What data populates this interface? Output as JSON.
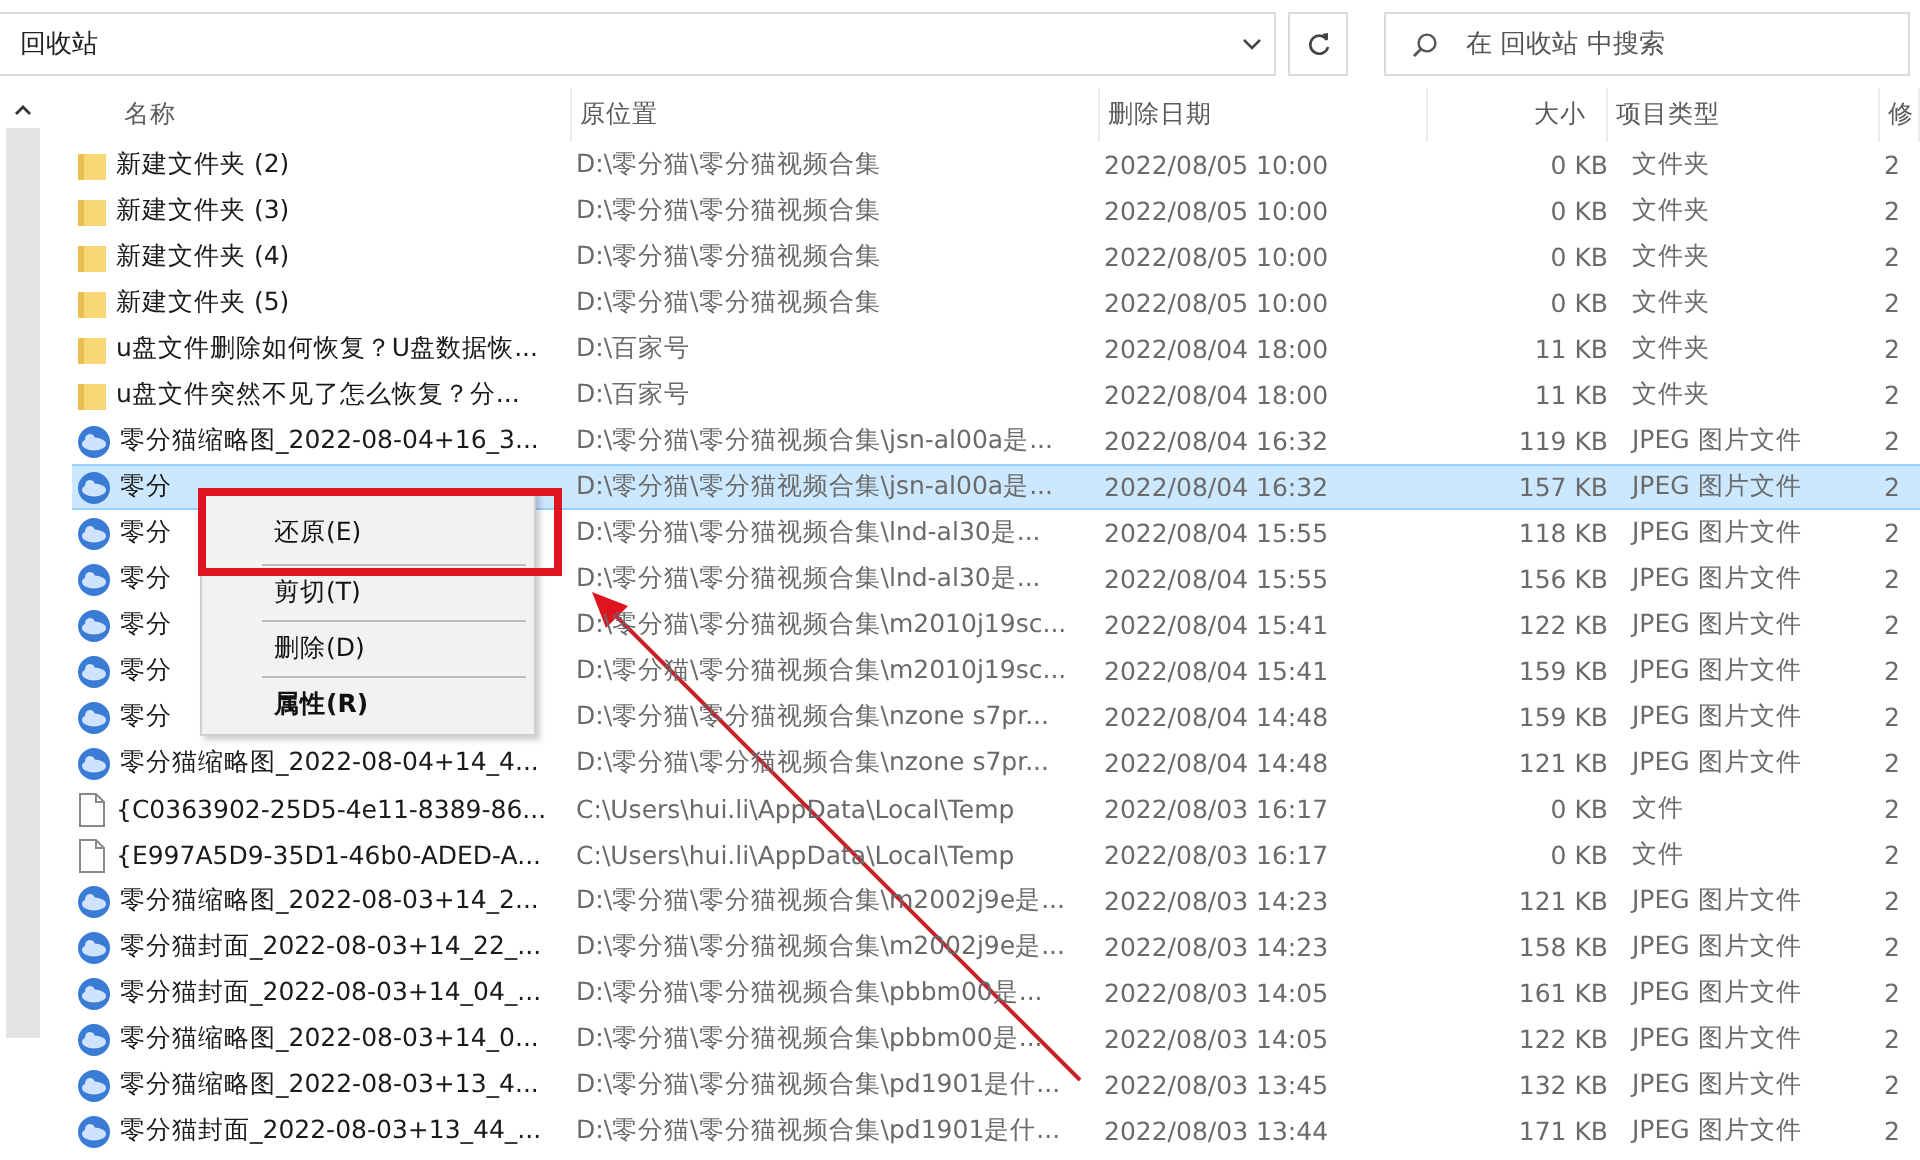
{
  "address_bar": {
    "path": "回收站"
  },
  "search": {
    "placeholder": "在 回收站 中搜索"
  },
  "table": {
    "columns": [
      "名称",
      "原位置",
      "删除日期",
      "大小",
      "项目类型",
      "修"
    ],
    "rows": [
      {
        "kind": "folder",
        "selected": false,
        "cells": [
          "新建文件夹 (2)",
          "D:\\零分猫\\零分猫视频合集",
          "2022/08/05 10:00",
          "0 KB",
          "文件夹",
          "2"
        ]
      },
      {
        "kind": "folder",
        "selected": false,
        "cells": [
          "新建文件夹 (3)",
          "D:\\零分猫\\零分猫视频合集",
          "2022/08/05 10:00",
          "0 KB",
          "文件夹",
          "2"
        ]
      },
      {
        "kind": "folder",
        "selected": false,
        "cells": [
          "新建文件夹 (4)",
          "D:\\零分猫\\零分猫视频合集",
          "2022/08/05 10:00",
          "0 KB",
          "文件夹",
          "2"
        ]
      },
      {
        "kind": "folder",
        "selected": false,
        "cells": [
          "新建文件夹 (5)",
          "D:\\零分猫\\零分猫视频合集",
          "2022/08/05 10:00",
          "0 KB",
          "文件夹",
          "2"
        ]
      },
      {
        "kind": "folder",
        "selected": false,
        "cells": [
          "u盘文件删除如何恢复？U盘数据恢...",
          "D:\\百家号",
          "2022/08/04 18:00",
          "11 KB",
          "文件夹",
          "2"
        ]
      },
      {
        "kind": "folder",
        "selected": false,
        "cells": [
          "u盘文件突然不见了怎么恢复？分...",
          "D:\\百家号",
          "2022/08/04 18:00",
          "11 KB",
          "文件夹",
          "2"
        ]
      },
      {
        "kind": "image",
        "selected": false,
        "cells": [
          "零分猫缩略图_2022-08-04+16_3...",
          "D:\\零分猫\\零分猫视频合集\\jsn-al00a是...",
          "2022/08/04 16:32",
          "119 KB",
          "JPEG 图片文件",
          "2"
        ]
      },
      {
        "kind": "image",
        "selected": true,
        "cells": [
          "零分",
          "D:\\零分猫\\零分猫视频合集\\jsn-al00a是...",
          "2022/08/04 16:32",
          "157 KB",
          "JPEG 图片文件",
          "2"
        ]
      },
      {
        "kind": "image",
        "selected": false,
        "cells": [
          "零分",
          "D:\\零分猫\\零分猫视频合集\\lnd-al30是...",
          "2022/08/04 15:55",
          "118 KB",
          "JPEG 图片文件",
          "2"
        ]
      },
      {
        "kind": "image",
        "selected": false,
        "cells": [
          "零分",
          "D:\\零分猫\\零分猫视频合集\\lnd-al30是...",
          "2022/08/04 15:55",
          "156 KB",
          "JPEG 图片文件",
          "2"
        ]
      },
      {
        "kind": "image",
        "selected": false,
        "cells": [
          "零分",
          "D:\\零分猫\\零分猫视频合集\\m2010j19sc...",
          "2022/08/04 15:41",
          "122 KB",
          "JPEG 图片文件",
          "2"
        ]
      },
      {
        "kind": "image",
        "selected": false,
        "cells": [
          "零分",
          "D:\\零分猫\\零分猫视频合集\\m2010j19sc...",
          "2022/08/04 15:41",
          "159 KB",
          "JPEG 图片文件",
          "2"
        ]
      },
      {
        "kind": "image",
        "selected": false,
        "cells": [
          "零分",
          "D:\\零分猫\\零分猫视频合集\\nzone s7pr...",
          "2022/08/04 14:48",
          "159 KB",
          "JPEG 图片文件",
          "2"
        ]
      },
      {
        "kind": "image",
        "selected": false,
        "cells": [
          "零分猫缩略图_2022-08-04+14_4...",
          "D:\\零分猫\\零分猫视频合集\\nzone s7pr...",
          "2022/08/04 14:48",
          "121 KB",
          "JPEG 图片文件",
          "2"
        ]
      },
      {
        "kind": "file",
        "selected": false,
        "cells": [
          "{C0363902-25D5-4e11-8389-86...",
          "C:\\Users\\hui.li\\AppData\\Local\\Temp",
          "2022/08/03 16:17",
          "0 KB",
          "文件",
          "2"
        ]
      },
      {
        "kind": "file",
        "selected": false,
        "cells": [
          "{E997A5D9-35D1-46b0-ADED-A...",
          "C:\\Users\\hui.li\\AppData\\Local\\Temp",
          "2022/08/03 16:17",
          "0 KB",
          "文件",
          "2"
        ]
      },
      {
        "kind": "image",
        "selected": false,
        "cells": [
          "零分猫缩略图_2022-08-03+14_2...",
          "D:\\零分猫\\零分猫视频合集\\m2002j9e是...",
          "2022/08/03 14:23",
          "121 KB",
          "JPEG 图片文件",
          "2"
        ]
      },
      {
        "kind": "image",
        "selected": false,
        "cells": [
          "零分猫封面_2022-08-03+14_22_...",
          "D:\\零分猫\\零分猫视频合集\\m2002j9e是...",
          "2022/08/03 14:23",
          "158 KB",
          "JPEG 图片文件",
          "2"
        ]
      },
      {
        "kind": "image",
        "selected": false,
        "cells": [
          "零分猫封面_2022-08-03+14_04_...",
          "D:\\零分猫\\零分猫视频合集\\pbbm00是...",
          "2022/08/03 14:05",
          "161 KB",
          "JPEG 图片文件",
          "2"
        ]
      },
      {
        "kind": "image",
        "selected": false,
        "cells": [
          "零分猫缩略图_2022-08-03+14_0...",
          "D:\\零分猫\\零分猫视频合集\\pbbm00是...",
          "2022/08/03 14:05",
          "122 KB",
          "JPEG 图片文件",
          "2"
        ]
      },
      {
        "kind": "image",
        "selected": false,
        "cells": [
          "零分猫缩略图_2022-08-03+13_4...",
          "D:\\零分猫\\零分猫视频合集\\pd1901是什...",
          "2022/08/03 13:45",
          "132 KB",
          "JPEG 图片文件",
          "2"
        ]
      },
      {
        "kind": "image",
        "selected": false,
        "cells": [
          "零分猫封面_2022-08-03+13_44_...",
          "D:\\零分猫\\零分猫视频合集\\pd1901是什...",
          "2022/08/03 13:44",
          "171 KB",
          "JPEG 图片文件",
          "2"
        ]
      }
    ]
  },
  "context_menu": {
    "items": [
      {
        "label": "还原(E)",
        "default": false,
        "highlighted": true
      },
      {
        "label": "剪切(T)",
        "default": false,
        "highlighted": false
      },
      {
        "label": "删除(D)",
        "default": false,
        "highlighted": false
      },
      {
        "label": "属性(R)",
        "default": true,
        "highlighted": false
      }
    ]
  }
}
